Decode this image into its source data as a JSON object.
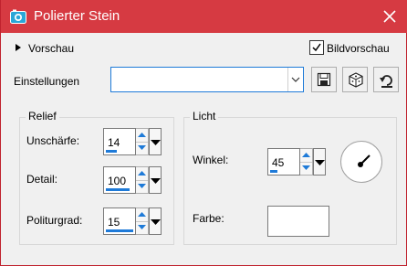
{
  "title": "Polierter Stein",
  "accent_color": "#d63a42",
  "focus_color": "#1e7ad8",
  "title_icon": "camera-icon",
  "close_icon": "close-icon",
  "preview": {
    "label": "Vorschau",
    "expand_icon": "triangle-right-icon"
  },
  "bildvorschau": {
    "label": "Bildvorschau",
    "checked": true
  },
  "settings": {
    "label": "Einstellungen",
    "value": "",
    "buttons": [
      {
        "name": "save-preset-button",
        "icon": "floppy-disk-icon"
      },
      {
        "name": "randomize-button",
        "icon": "dice-icon"
      },
      {
        "name": "reset-button",
        "icon": "undo-arrow-icon"
      }
    ]
  },
  "relief": {
    "label": "Relief",
    "fields": [
      {
        "label": "Unschärfe:",
        "value": "14"
      },
      {
        "label": "Detail:",
        "value": "100"
      },
      {
        "label": "Politurgrad:",
        "value": "15"
      }
    ]
  },
  "licht": {
    "label": "Licht",
    "winkel": {
      "label": "Winkel:",
      "value": "45"
    },
    "farbe": {
      "label": "Farbe:",
      "color": "#ffffff"
    }
  }
}
